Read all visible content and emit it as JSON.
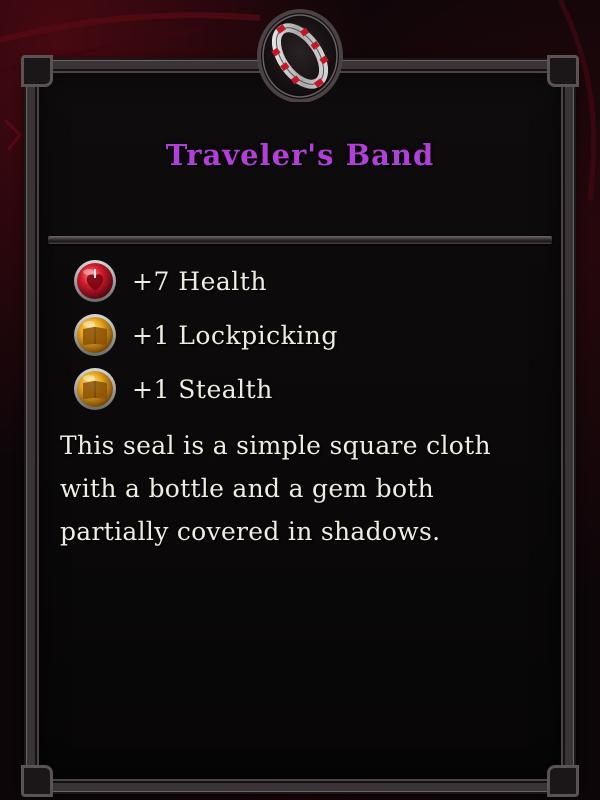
{
  "tooltip": {
    "item_name": "Traveler's Band",
    "item_icon": "ring-icon",
    "title_color": "#b040d8",
    "stats": [
      {
        "icon": "health-heart-icon",
        "text": "+7 Health",
        "icon_color": "#c0182a"
      },
      {
        "icon": "book-icon",
        "text": "+1 Lockpicking",
        "icon_color": "#e0a020"
      },
      {
        "icon": "book-icon",
        "text": "+1 Stealth",
        "icon_color": "#e0a020"
      }
    ],
    "description": "This seal is a simple square cloth with a bottle and a gem both partially covered in shadows."
  }
}
